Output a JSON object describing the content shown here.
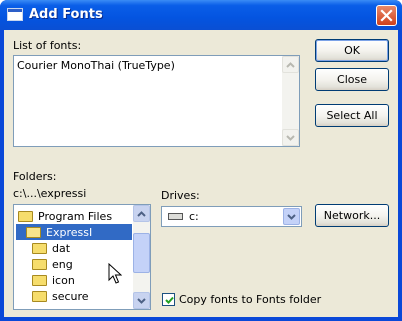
{
  "window": {
    "title": "Add Fonts"
  },
  "fonts": {
    "label": "List of fonts:",
    "items": [
      "Courier MonoThai (TrueType)"
    ]
  },
  "folders": {
    "label": "Folders:",
    "path": "c:\\...\\expressi",
    "items": [
      {
        "label": "Program Files",
        "icon": "open-folder-icon",
        "selected": false
      },
      {
        "label": "ExpressI",
        "icon": "open-folder-icon",
        "selected": true
      },
      {
        "label": "dat",
        "icon": "folder-icon",
        "selected": false
      },
      {
        "label": "eng",
        "icon": "folder-icon",
        "selected": false
      },
      {
        "label": "icon",
        "icon": "folder-icon",
        "selected": false
      },
      {
        "label": "secure",
        "icon": "folder-icon",
        "selected": false
      }
    ]
  },
  "drives": {
    "label": "Drives:",
    "selected": "c:"
  },
  "buttons": {
    "ok": "OK",
    "close": "Close",
    "select_all": "Select All",
    "network": "Network..."
  },
  "copy_option": {
    "label": "Copy fonts to Fonts folder",
    "checked": true
  },
  "colors": {
    "titlebar": "#0454e0",
    "selection": "#316ac5",
    "dialog_bg": "#ece9d8",
    "close_button": "#d0401c"
  }
}
